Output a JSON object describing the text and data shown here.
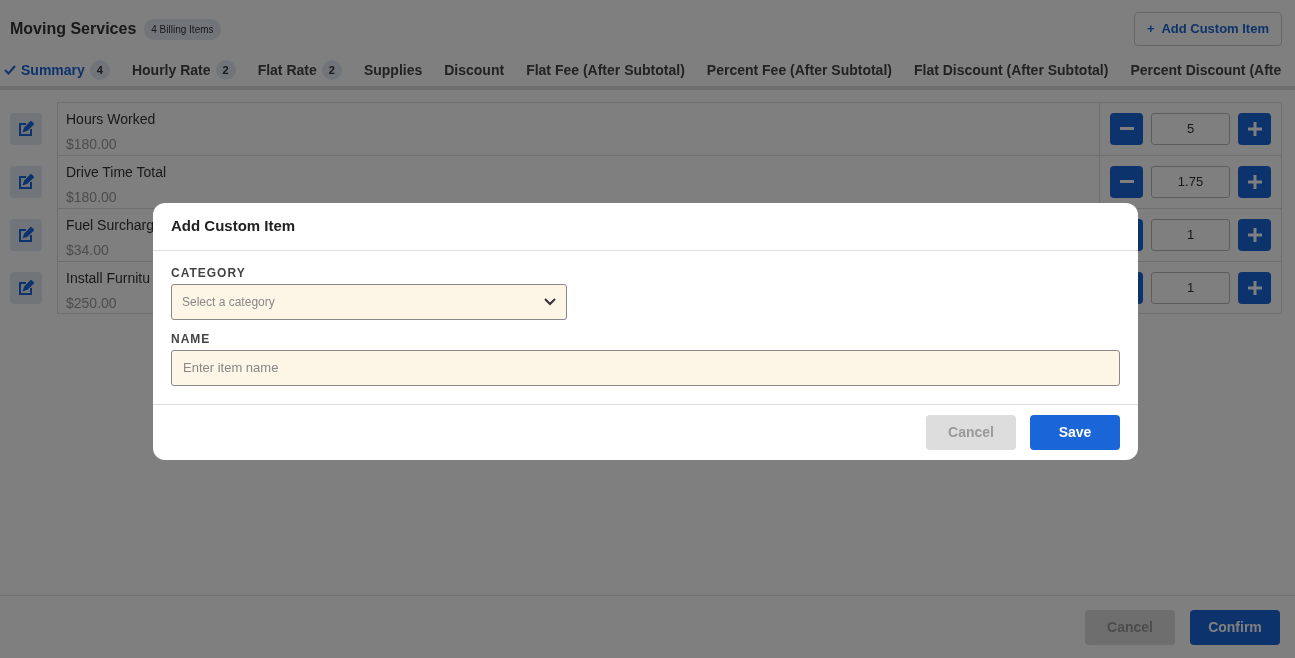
{
  "header": {
    "title": "Moving Services",
    "badge": "4 Billing Items",
    "add_button": {
      "icon": "+",
      "label": "Add Custom Item"
    }
  },
  "tabs": [
    {
      "label": "Summary",
      "count": "4",
      "selected": true
    },
    {
      "label": "Hourly Rate",
      "count": "2",
      "selected": false
    },
    {
      "label": "Flat Rate",
      "count": "2",
      "selected": false
    },
    {
      "label": "Supplies",
      "selected": false
    },
    {
      "label": "Discount",
      "selected": false
    },
    {
      "label": "Flat Fee (After Subtotal)",
      "selected": false
    },
    {
      "label": "Percent Fee (After Subtotal)",
      "selected": false
    },
    {
      "label": "Flat Discount (After Subtotal)",
      "selected": false
    },
    {
      "label": "Percent Discount (Afte",
      "selected": false
    }
  ],
  "items": [
    {
      "name": "Hours Worked",
      "price": "$180.00",
      "quantity": "5"
    },
    {
      "name": "Drive Time Total",
      "price": "$180.00",
      "quantity": "1.75"
    },
    {
      "name": "Fuel Surcharg",
      "price": "$34.00",
      "quantity": "1"
    },
    {
      "name": "Install Furnitu",
      "price": "$250.00",
      "quantity": "1"
    }
  ],
  "footer": {
    "buttons": [
      {
        "label": "Cancel",
        "kind": "secondary"
      },
      {
        "label": "Confirm",
        "kind": "primary"
      }
    ]
  },
  "modal": {
    "title": "Add Custom Item",
    "category_label": "CATEGORY",
    "category_placeholder": "Select a category",
    "name_label": "NAME",
    "name_placeholder": "Enter item name",
    "buttons": [
      {
        "label": "Cancel",
        "kind": "secondary"
      },
      {
        "label": "Save",
        "kind": "primary"
      }
    ]
  }
}
